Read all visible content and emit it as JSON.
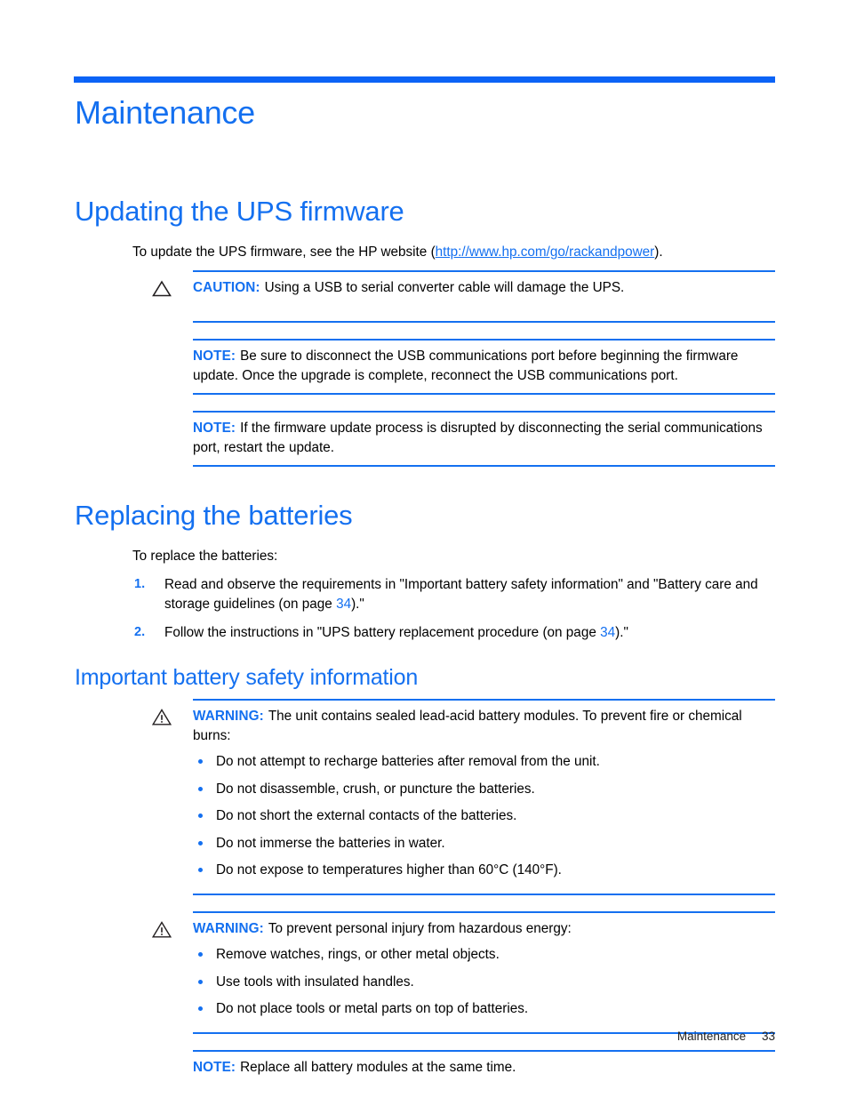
{
  "document": {
    "chapter_title": "Maintenance",
    "footer_section": "Maintenance",
    "footer_page": "33",
    "accent_color": "#1470f0",
    "rule_color": "#0b63f6"
  },
  "sections": {
    "updating_firmware": {
      "heading": "Updating the UPS firmware",
      "intro_before_link": "To update the UPS firmware, see the HP website (",
      "link_text": "http://www.hp.com/go/rackandpower",
      "intro_after_link": ").",
      "caution": {
        "label": "CAUTION:",
        "icon": "warning-triangle-icon",
        "text": "Using a USB to serial converter cable will damage the UPS."
      },
      "note_1": {
        "label": "NOTE:",
        "text": "Be sure to disconnect the USB communications port before beginning the firmware update. Once the upgrade is complete, reconnect the USB communications port."
      },
      "note_2": {
        "label": "NOTE:",
        "text": "If the firmware update process is disrupted by disconnecting the serial communications port, restart the update."
      }
    },
    "replacing_batteries": {
      "heading": "Replacing the batteries",
      "intro": "To replace the batteries:",
      "steps": [
        {
          "num": "1.",
          "text_before_xref": "Read and observe the requirements in \"Important battery safety information\" and \"Battery care and storage guidelines (on page ",
          "xref": "34",
          "text_after_xref": ").\""
        },
        {
          "num": "2.",
          "text_before_xref": "Follow the instructions in \"UPS battery replacement procedure (on page ",
          "xref": "34",
          "text_after_xref": ").\""
        }
      ]
    },
    "battery_safety": {
      "heading": "Important battery safety information",
      "warning_1": {
        "label": "WARNING:",
        "icon": "warning-triangle-exclamation-icon",
        "text": "The unit contains sealed lead-acid battery modules. To prevent fire or chemical burns:",
        "bullets": [
          "Do not attempt to recharge batteries after removal from the unit.",
          "Do not disassemble, crush, or puncture the batteries.",
          "Do not short the external contacts of the batteries.",
          "Do not immerse the batteries in water.",
          "Do not expose to temperatures higher than 60°C (140°F)."
        ]
      },
      "warning_2": {
        "label": "WARNING:",
        "icon": "warning-triangle-exclamation-icon",
        "text": "To prevent personal injury from hazardous energy:",
        "bullets": [
          "Remove watches, rings, or other metal objects.",
          "Use tools with insulated handles.",
          "Do not place tools or metal parts on top of batteries."
        ]
      },
      "note": {
        "label": "NOTE:",
        "text": "Replace all battery modules at the same time."
      }
    }
  }
}
